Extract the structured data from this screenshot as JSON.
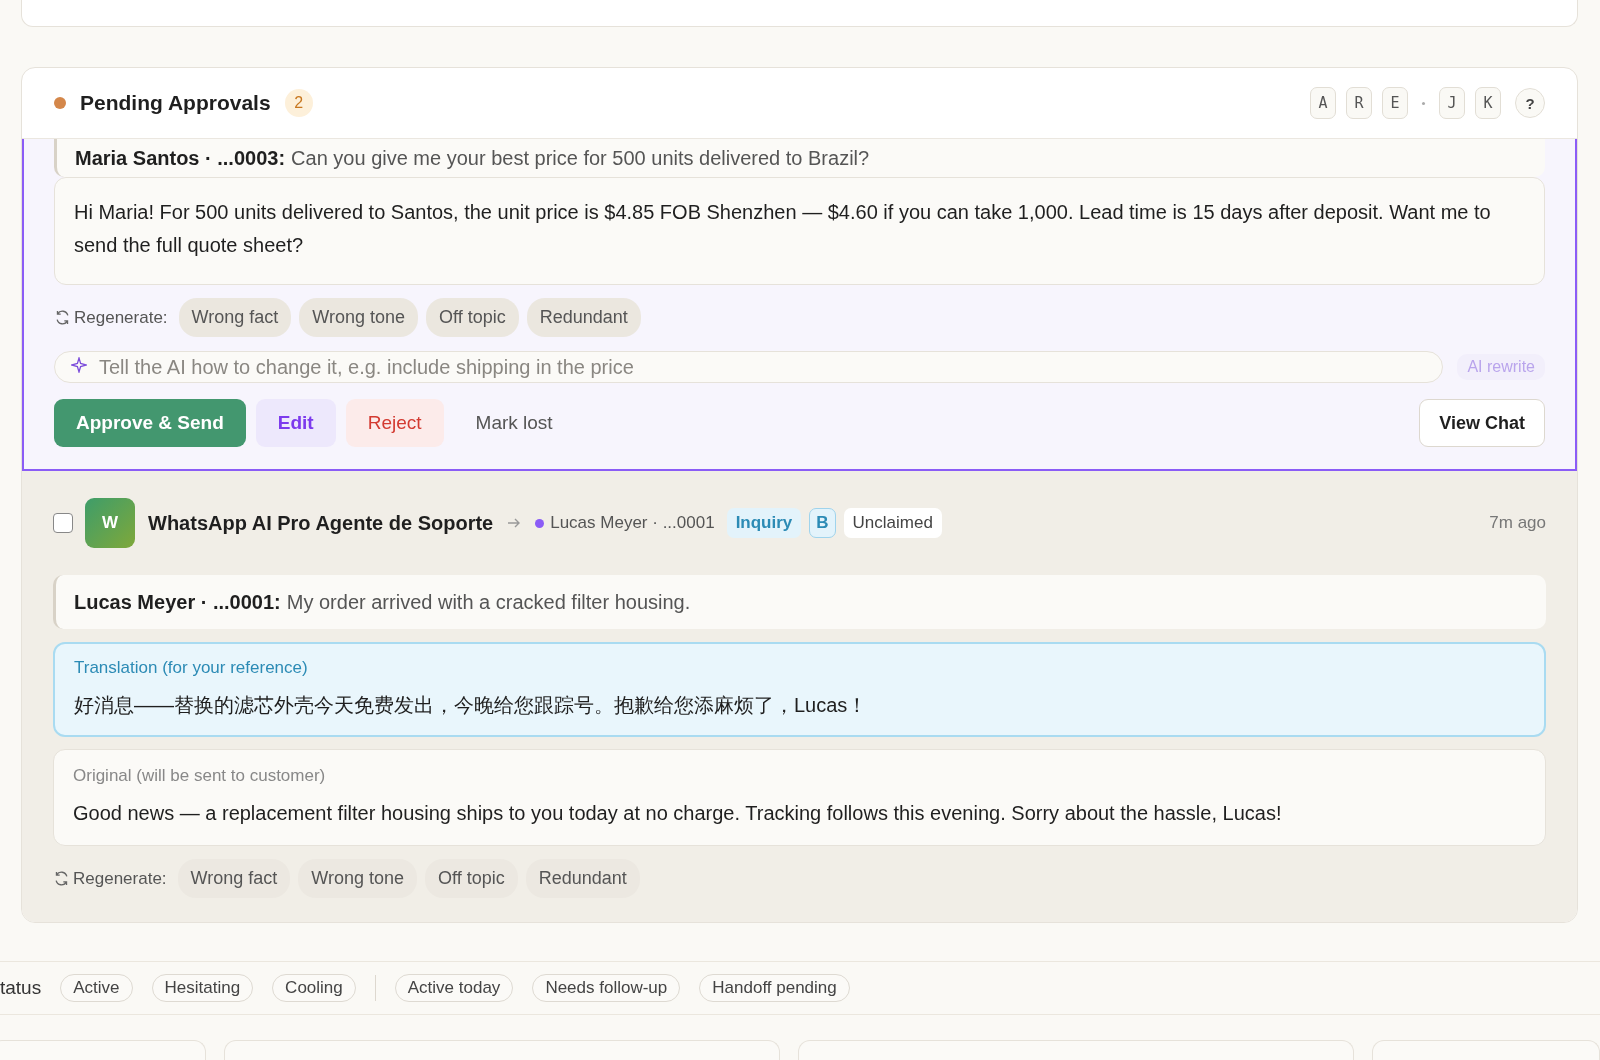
{
  "approvals": {
    "title": "Pending Approvals",
    "count": "2",
    "shortcuts": [
      "A",
      "R",
      "E",
      "J",
      "K"
    ],
    "help": "?"
  },
  "items": [
    {
      "selected": true,
      "quoted": {
        "sender": "Maria Santos · ...0003:",
        "text": "Can you give me your best price for 500 units delivered to Brazil?"
      },
      "reply": "Hi Maria! For 500 units delivered to Santos, the unit price is $4.85 FOB Shenzhen — $4.60 if you can take 1,000. Lead time is 15 days after deposit. Want me to send the full quote sheet?",
      "regenerate_label": "Regenerate:",
      "reasons": [
        "Wrong fact",
        "Wrong tone",
        "Off topic",
        "Redundant"
      ],
      "rewrite": {
        "placeholder": "Tell the AI how to change it, e.g. include shipping in the price",
        "button": "AI rewrite"
      },
      "actions": [
        {
          "label": "Approve & Send",
          "kind": "primary"
        },
        {
          "label": "Edit",
          "kind": "edit"
        },
        {
          "label": "Reject",
          "kind": "danger"
        },
        {
          "label": "Mark lost",
          "kind": "plain"
        }
      ],
      "view_chat": "View Chat"
    },
    {
      "selected": false,
      "checked": false,
      "avatar": "W",
      "agent": "WhatsApp AI Pro Agente de Soporte",
      "contact": {
        "name": "Lucas Meyer · ...0001",
        "color": "#8b5cf6"
      },
      "tags": [
        {
          "label": "Inquiry",
          "kind": "intent"
        },
        {
          "label": "B",
          "kind": "grade"
        },
        {
          "label": "Unclaimed",
          "kind": "claim"
        }
      ],
      "time": "7m ago",
      "quoted": {
        "sender": "Lucas Meyer · ...0001:",
        "text": "My order arrived with a cracked filter housing."
      },
      "translation": {
        "label": "Translation (for your reference)",
        "text": "好消息——替换的滤芯外壳今天免费发出，今晚给您跟踪号。抱歉给您添麻烦了，Lucas！"
      },
      "original": {
        "label": "Original (will be sent to customer)",
        "text": "Good news — a replacement filter housing ships to you today at no charge. Tracking follows this evening. Sorry about the hassle, Lucas!"
      },
      "regenerate_label": "Regenerate:",
      "reasons": [
        "Wrong fact",
        "Wrong tone",
        "Off topic",
        "Redundant"
      ]
    }
  ],
  "filters": {
    "label": "tatus",
    "groups": [
      [
        "Active",
        "Hesitating",
        "Cooling"
      ],
      [
        "Active today",
        "Needs follow-up",
        "Handoff pending"
      ]
    ]
  }
}
